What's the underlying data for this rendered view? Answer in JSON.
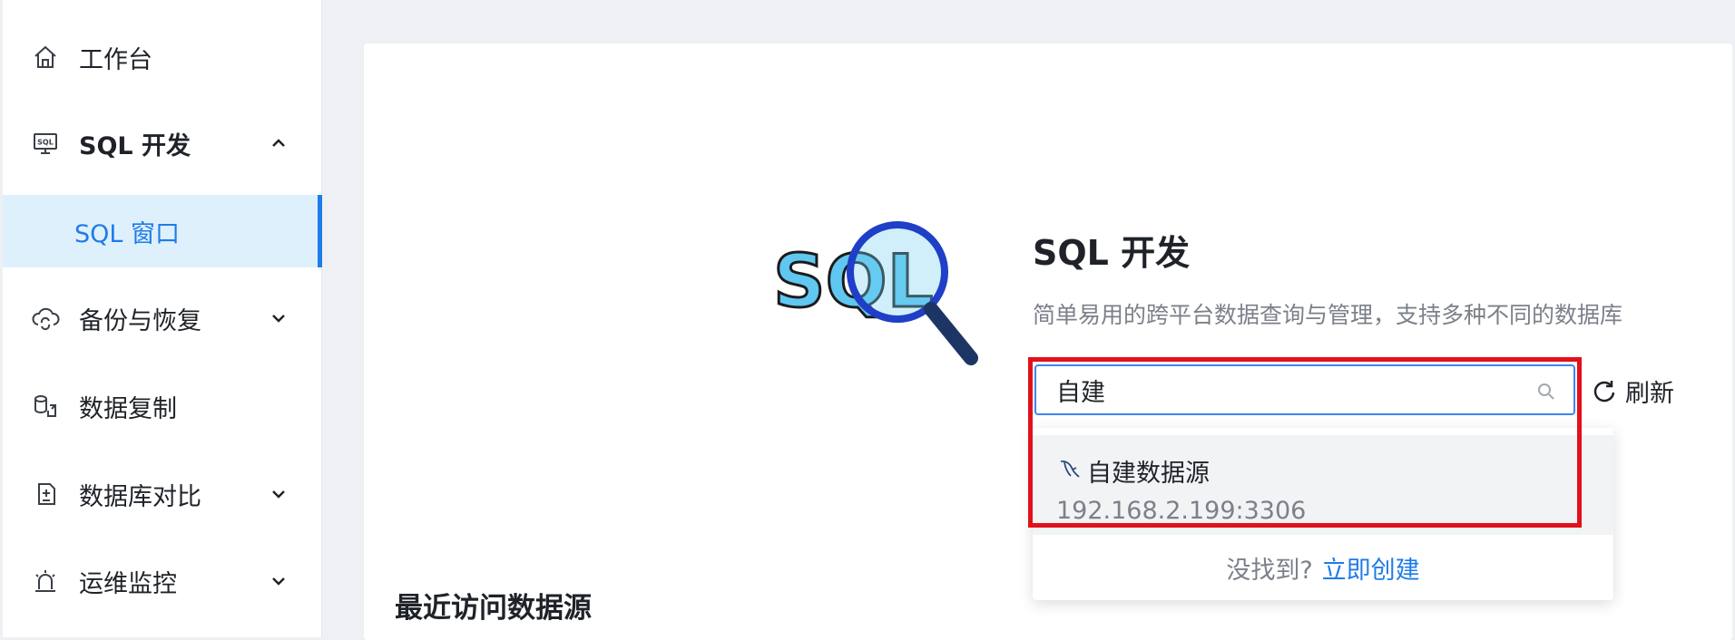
{
  "sidebar": {
    "items": [
      {
        "label": "工作台",
        "icon": "home-icon"
      },
      {
        "label": "SQL 开发",
        "icon": "sql-monitor-icon",
        "expanded": true
      },
      {
        "label": "备份与恢复",
        "icon": "cloud-sync-icon"
      },
      {
        "label": "数据复制",
        "icon": "data-copy-icon"
      },
      {
        "label": "数据库对比",
        "icon": "db-compare-icon"
      },
      {
        "label": "运维监控",
        "icon": "alarm-icon"
      }
    ],
    "sub_items": [
      {
        "label": "SQL 窗口",
        "active": true
      }
    ]
  },
  "main": {
    "illustration_text": "SQL",
    "title": "SQL 开发",
    "subtitle": "简单易用的跨平台数据查询与管理，支持多种不同的数据库",
    "search": {
      "value": "自建",
      "placeholder": ""
    },
    "refresh_label": "刷新",
    "dropdown": {
      "options": [
        {
          "name": "自建数据源",
          "address": "192.168.2.199:3306",
          "icon": "mysql-icon"
        }
      ],
      "footer_text": "没找到?",
      "footer_link": "立即创建"
    },
    "recent_title": "最近访问数据源"
  },
  "colors": {
    "accent": "#1e7ce8",
    "active_bg": "#dff0fd",
    "highlight_outline": "#e1111b"
  }
}
